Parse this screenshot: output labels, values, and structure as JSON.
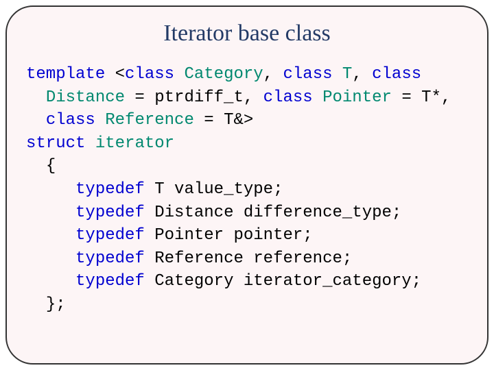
{
  "title": "Iterator base class",
  "code": {
    "kw_template": "template",
    "kw_class1": "class",
    "tok_Category": "Category",
    "sym_comma1": ", ",
    "kw_class2": "class",
    "tok_T": "T",
    "sym_comma2": ", ",
    "kw_class3": "class",
    "tok_Distance": "Distance",
    "sym_eq1": " = ptrdiff_t, ",
    "kw_class4": "class",
    "tok_Pointer": "Pointer",
    "sym_eq2": " = T*, ",
    "kw_class5": "class",
    "tok_Reference": "Reference",
    "sym_eq3": " = T&>",
    "kw_struct": "struct",
    "tok_iterator": "iterator",
    "sym_openbrace": "{",
    "kw_typedef1": "typedef",
    "line1": " T value_type;",
    "kw_typedef2": "typedef",
    "line2": " Distance difference_type;",
    "kw_typedef3": "typedef",
    "line3": " Pointer pointer;",
    "kw_typedef4": "typedef",
    "line4": " Reference reference;",
    "kw_typedef5": "typedef",
    "line5": " Category iterator_category;",
    "sym_closebrace": "};"
  }
}
